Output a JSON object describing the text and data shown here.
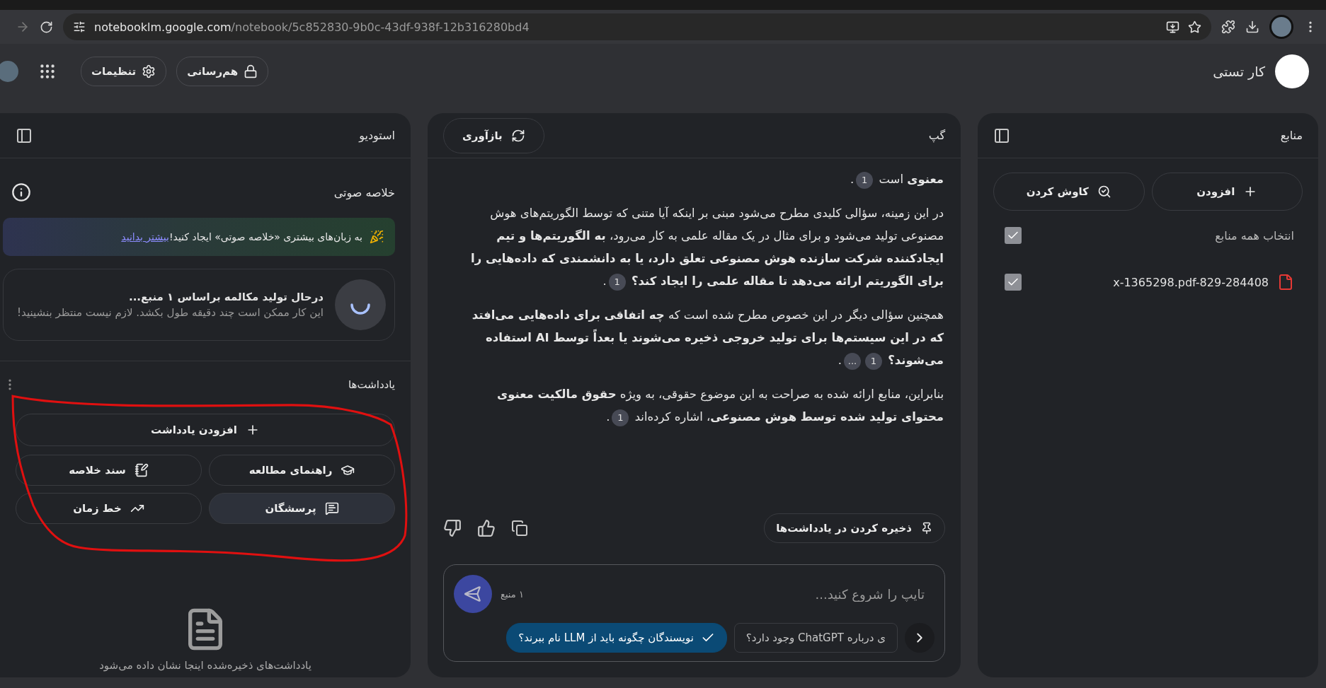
{
  "browser": {
    "url_host": "notebooklm.google.com",
    "url_path": "/notebook/5c852830-9b0c-43df-938f-12b316280bd4"
  },
  "header": {
    "title": "کار تستی",
    "share": "هم‌رسانی",
    "settings": "تنظیمات"
  },
  "sources": {
    "title": "منابع",
    "add": "افزودن",
    "discover": "کاوش کردن",
    "select_all": {
      "label": "انتخاب همه منابع",
      "checked": true
    },
    "items": [
      {
        "name": "x-1365298.pdf-829-284408",
        "checked": true
      }
    ]
  },
  "chat": {
    "title": "گپ",
    "refresh": "بازآوری",
    "paragraphs": [
      {
        "text": "**معنوی** است",
        "citations": [
          "1"
        ],
        "end": "."
      },
      {
        "text": "در این زمینه، سؤالی کلیدی مطرح می‌شود مبنی بر اینکه آیا متنی که توسط الگوریتم‌های هوش مصنوعی تولید می‌شود و برای مثال در یک مقاله علمی به کار می‌رود، **به الگوریتم‌ها و تیم ایجادکننده شرکت سازنده هوش مصنوعی تعلق دارد، یا به دانشمندی که داده‌هایی را برای الگوریتم ارائه می‌دهد تا مقاله علمی را ایجاد کند؟**",
        "citations": [
          "1"
        ],
        "end": "."
      },
      {
        "text": "همچنین سؤالی دیگر در این خصوص مطرح شده است که **چه اتفاقی برای داده‌هایی می‌افتد که در این سیستم‌ها برای تولید خروجی ذخیره می‌شوند یا بعداً توسط AI استفاده می‌شوند؟**",
        "citations": [
          "1",
          "..."
        ],
        "end": "."
      },
      {
        "text": "بنابراین، منابع ارائه شده به صراحت به این موضوع حقوقی، به ویژه **حقوق مالکیت معنوی محتوای تولید شده توسط هوش مصنوعی**، اشاره کرده‌اند",
        "citations": [
          "1"
        ],
        "end": "."
      }
    ],
    "save_note": "ذخیره کردن در یادداشت‌ها",
    "input": {
      "placeholder": "تایپ را شروع کنید...",
      "source_count": "۱ منبع"
    },
    "suggestions": [
      {
        "text": "ی درباره ChatGPT وجود دارد؟",
        "selected": false
      },
      {
        "text": "نویسندگان چگونه باید از LLM نام ببرند؟",
        "selected": true
      }
    ]
  },
  "studio": {
    "title": "استودیو",
    "audio_title": "خلاصه صوتی",
    "banner": {
      "text": "به زبان‌های بیشتری «خلاصه صوتی» ایجاد کنید!",
      "link": "بیشتر بدانید"
    },
    "generating": {
      "title": "درحال تولید مکالمه براساس ۱ منبع...",
      "subtitle": "این کار ممکن است چند دقیقه طول بکشد. لازم نیست منتظر بنشینید!"
    },
    "notes_title": "یادداشت‌ها",
    "add_note": "افزودن یادداشت",
    "note_actions": [
      {
        "kind": "study",
        "label": "راهنمای مطالعه",
        "selected": false
      },
      {
        "kind": "briefing",
        "label": "سند خلاصه",
        "selected": false
      },
      {
        "kind": "faq",
        "label": "پرسشگان",
        "selected": true
      },
      {
        "kind": "timeline",
        "label": "خط زمان",
        "selected": false
      }
    ],
    "empty_text": "یادداشت‌های ذخیره‌شده اینجا نشان داده می‌شود"
  }
}
